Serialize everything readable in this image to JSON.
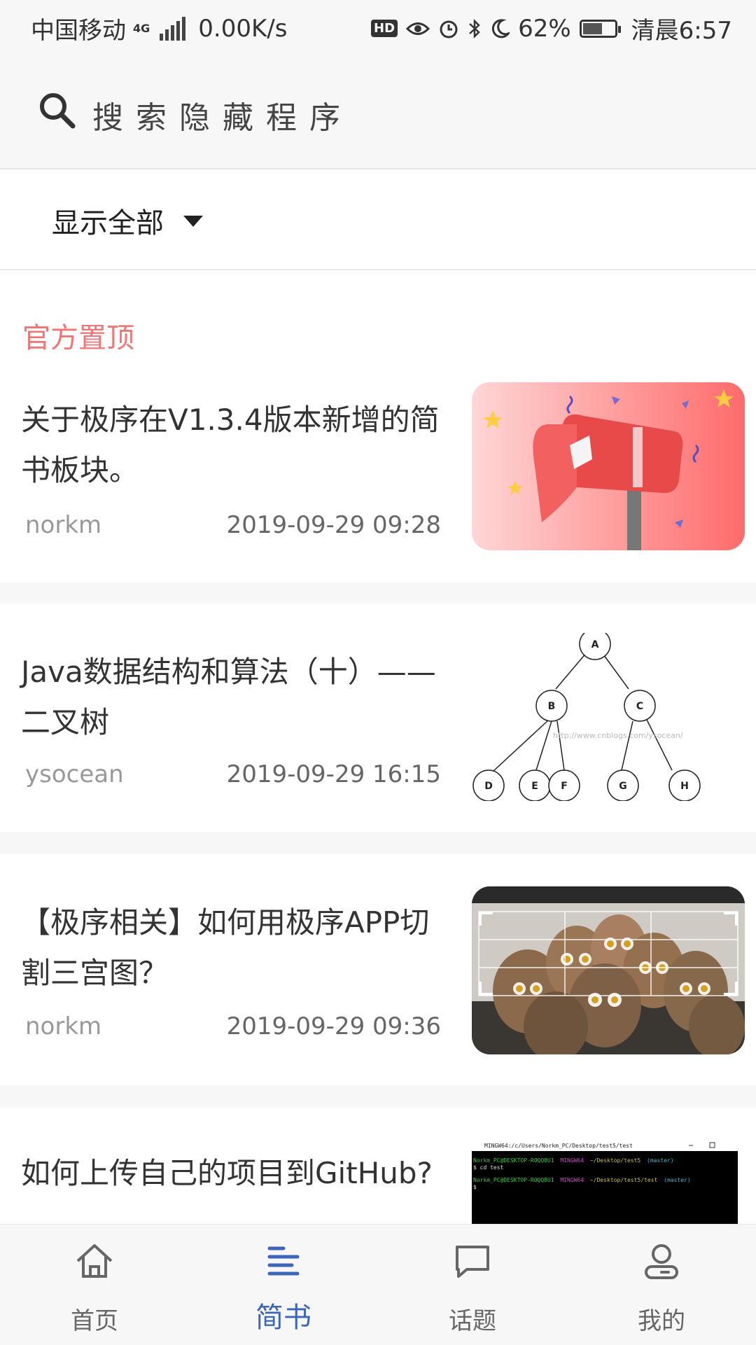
{
  "status_bar": {
    "carrier": "中国移动",
    "network": "4G",
    "speed": "0.00K/s",
    "hd": "HD",
    "battery": "62%",
    "battery_level": 0.62,
    "time": "清晨6:57"
  },
  "search": {
    "placeholder": "搜索隐藏程序"
  },
  "filter": {
    "label": "显示全部"
  },
  "section": {
    "title": "官方置顶"
  },
  "items": [
    {
      "title": "关于极序在V1.3.4版本新增的简书板块。",
      "author": "norkm",
      "date": "2019-09-29 09:28",
      "thumb": "mailbox-illustration"
    },
    {
      "title": "Java数据结构和算法（十）——二叉树",
      "author": "ysocean",
      "date": "2019-09-29 16:15",
      "thumb": "binary-tree-diagram",
      "tree_nodes": [
        "A",
        "B",
        "C",
        "D",
        "E",
        "F",
        "G",
        "H"
      ],
      "watermark": "http://www.cnblogs.com/ysocean/"
    },
    {
      "title": "【极序相关】如何用极序APP切割三宫图？",
      "author": "norkm",
      "date": "2019-09-29 09:36",
      "thumb": "owls-photo"
    },
    {
      "title": "如何上传自己的项目到GitHub?",
      "author": "",
      "date": "",
      "thumb": "terminal-screenshot",
      "terminal": {
        "title": "MINGW64:/c/Users/Norkm_PC/Desktop/test5/test",
        "line1_user": "Norkm_PC@DESKTOP-R0QQ8U1",
        "line1_env": "MINGW64",
        "line1_path": "~/Desktop/test5",
        "line1_branch": "(master)",
        "cmd": "$ cd test",
        "line2_user": "Norkm_PC@DESKTOP-R0QQ8U1",
        "line2_env": "MINGW64",
        "line2_path": "~/Desktop/test5/test",
        "line2_branch": "(master)",
        "prompt": "$"
      }
    }
  ],
  "tabs": [
    {
      "label": "首页",
      "icon": "home-icon",
      "active": false
    },
    {
      "label": "简书",
      "icon": "article-icon",
      "active": true
    },
    {
      "label": "话题",
      "icon": "chat-icon",
      "active": false
    },
    {
      "label": "我的",
      "icon": "profile-icon",
      "active": false
    }
  ],
  "colors": {
    "accent": "#3e66b8",
    "section_label": "#f07676",
    "text": "#333333",
    "muted": "#999999"
  }
}
